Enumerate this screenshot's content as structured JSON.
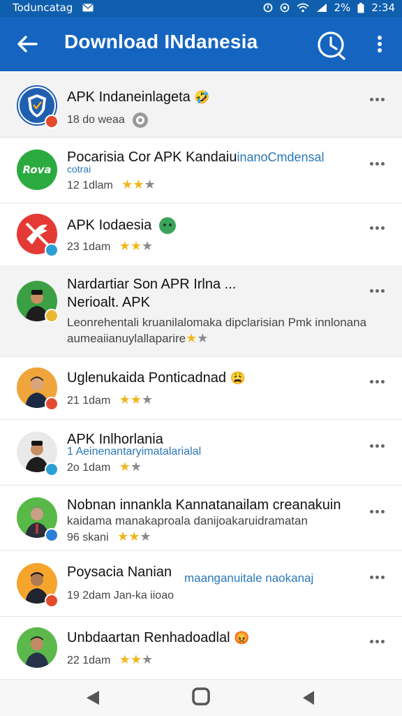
{
  "status_bar": {
    "left_text": "Toduncatag",
    "right_text": "2%",
    "time": "2:34",
    "icons": [
      "mail-icon",
      "alarm-icon",
      "location-icon",
      "wifi-icon",
      "signal-icon",
      "battery-icon"
    ]
  },
  "app_bar": {
    "title": "Download INdanesia",
    "icons": [
      "back-arrow-icon",
      "history-clock-icon",
      "more-vert-icon"
    ]
  },
  "items": [
    {
      "title": "APK Indaneinlageta",
      "meta": "18  do weaa",
      "emoji": "🤣"
    },
    {
      "logo_text": "Rova",
      "title": "Pocarisia Cor APK Kandaiu",
      "title_extra": "inanoCmdensal",
      "sub": "cotrai",
      "meta": "12 1dlam"
    },
    {
      "title": "APK Iodaesia",
      "meta": "23 1dam"
    },
    {
      "title": "Nardartiar Son APR Irlna ...",
      "title2": "Nerioalt. APK",
      "desc1": "Leonrehentali kruanilalomaka dipclarisian Pmk innlonana",
      "desc2": "aumeaiianuylallaparire"
    },
    {
      "title": "Uglenukaida Ponticadnad",
      "meta": "21 1dam",
      "emoji": "😩"
    },
    {
      "title": "APK Inlhorlania",
      "sub": "1 Aeinenantaryimatalarialal",
      "meta": "2o 1dam"
    },
    {
      "title": "Nobnan innankla Kannatanailam creanakuin",
      "desc1": "kaidama manakaproala danijoakaruidramatan",
      "meta": "96 skani"
    },
    {
      "title": "Poysacia Nanian",
      "title_extra": "maanganuitale naokanaj",
      "meta": "19 2dam  Jan-ka iioao"
    },
    {
      "title": "Unbdaartan Renhadoadlal",
      "meta": "22 1dam",
      "emoji": "😡"
    }
  ],
  "colors": {
    "primary": "#1565c0",
    "status": "#0f5fae",
    "star": "#f2b61c",
    "row_shaded": "#f3f3f3",
    "verified_badge": "#2a9fd6",
    "alert_badge": "#e24b2d",
    "gold_badge": "#e8b832"
  },
  "nav_icons": [
    "nav-back-icon",
    "nav-home-icon",
    "nav-recents-icon"
  ]
}
